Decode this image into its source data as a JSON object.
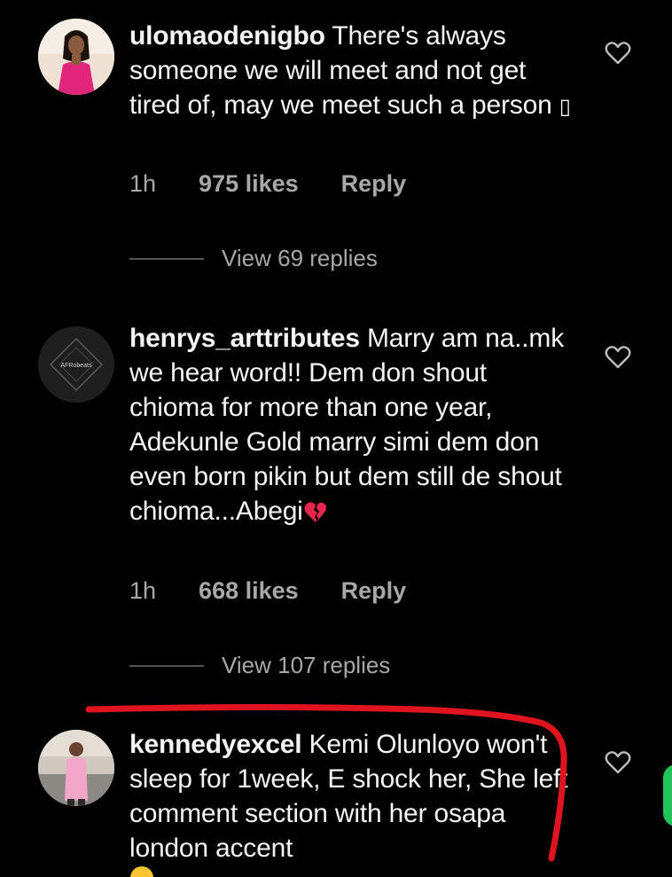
{
  "comments": [
    {
      "username": "ulomaodenigbo",
      "text": "There's always someone we will meet and not get tired of, may we meet such a person",
      "trailing_glyph": "▯",
      "time": "1h",
      "likes": "975 likes",
      "reply_label": "Reply",
      "view_replies": "View 69 replies",
      "avatar_icon": "profile-photo-woman-pink"
    },
    {
      "username": "henrys_arttributes",
      "text": "Marry am na..mk we hear word!! Dem don shout chioma for more than one year, Adekunle Gold marry simi dem don even born pikin but dem still de shout chioma...Abegi",
      "emoji": "broken-heart",
      "time": "1h",
      "likes": "668 likes",
      "reply_label": "Reply",
      "view_replies": "View 107 replies",
      "avatar_icon": "logo-avatar-dark",
      "avatar_text": "AFRobeats"
    },
    {
      "username": "kennedyexcel",
      "text": "Kemi Olunloyo won't sleep for 1week, E shock her, She left comment section with her osapa london accent",
      "avatar_icon": "profile-photo-man-pink-outfit"
    }
  ],
  "colors": {
    "background": "#000000",
    "primary_text": "#f4f4f4",
    "secondary_text": "#a8a8a8",
    "highlight_mark": "#e0141e",
    "side_button": "#22c35a"
  }
}
